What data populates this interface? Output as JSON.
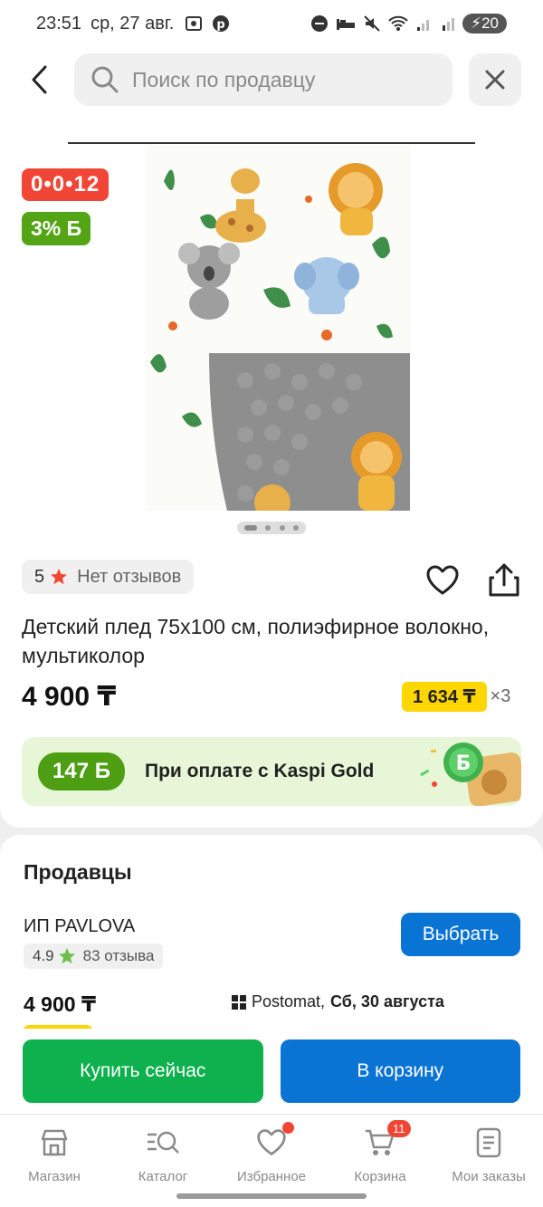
{
  "status_bar": {
    "time": "23:51",
    "date": "ср, 27 авг.",
    "battery": "20"
  },
  "search": {
    "placeholder": "Поиск по продавцу"
  },
  "product": {
    "badge_timer": "0•0•12",
    "badge_bonus": "3% Б",
    "rating_value": "5",
    "no_reviews": "Нет отзывов",
    "title": "Детский плед 75х100 см, полиэфирное волокно, мультиколор",
    "price": "4 900 ₸",
    "installment_amount": "1 634 ₸",
    "installment_multiplier": "×3",
    "bonus_amount": "147 Б",
    "bonus_text": "При оплате с Kaspi Gold",
    "bonus_coin": "Б",
    "image_slide": 1,
    "image_slides_total": 4
  },
  "sellers": {
    "title": "Продавцы",
    "items": [
      {
        "name": "ИП PAVLOVA",
        "rating": "4.9",
        "reviews": "83 отзыва",
        "choose_label": "Выбрать",
        "price": "4 900 ₸",
        "delivery_method": "Postomat,",
        "delivery_date": "Сб, 30 августа"
      }
    ]
  },
  "actions": {
    "buy_now": "Купить сейчас",
    "add_to_cart": "В корзину"
  },
  "tabbar": {
    "items": [
      {
        "label": "Магазин",
        "icon": "shop-icon"
      },
      {
        "label": "Каталог",
        "icon": "catalog-search-icon"
      },
      {
        "label": "Избранное",
        "icon": "heart-icon"
      },
      {
        "label": "Корзина",
        "icon": "cart-icon",
        "badge": "11"
      },
      {
        "label": "Мои заказы",
        "icon": "orders-icon"
      }
    ]
  },
  "colors": {
    "primary_blue": "#0a74d4",
    "buy_green": "#0eb14e",
    "bonus_green": "#4d9e12",
    "badge_red": "#f14635",
    "installment_yellow": "#ffd600"
  }
}
